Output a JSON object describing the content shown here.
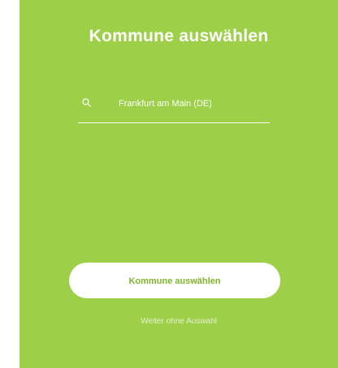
{
  "dialog": {
    "title": "Kommune auswählen",
    "search": {
      "icon": "search-icon",
      "value": "Frankfurt am Main (DE)"
    },
    "primary_button_label": "Kommune auswählen",
    "skip_link_label": "Weiter ohne Auswahl"
  },
  "colors": {
    "panel_background": "#9dcf48",
    "button_background": "#ffffff",
    "button_text": "#7fb52a",
    "text": "#ffffff"
  }
}
